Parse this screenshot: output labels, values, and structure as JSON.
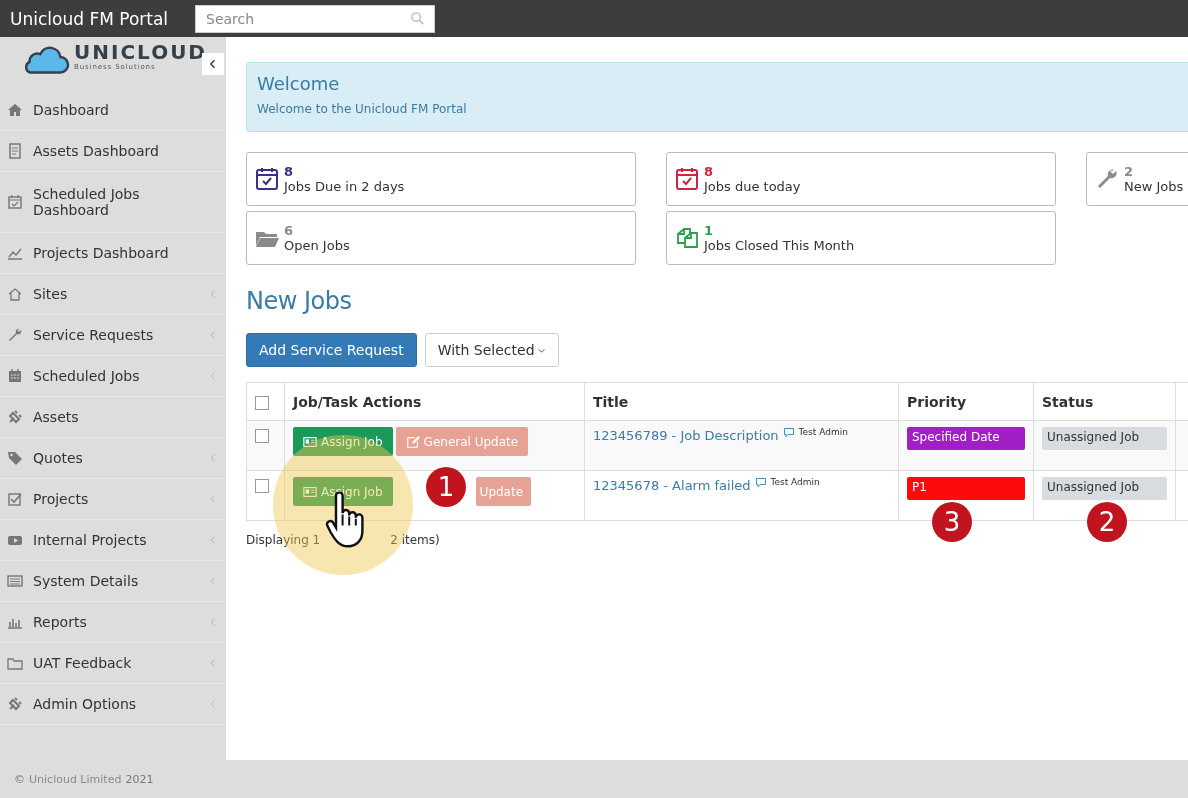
{
  "topbar": {
    "title": "Unicloud FM Portal",
    "search": {
      "placeholder": "Search"
    }
  },
  "logo": {
    "name": "UNICLOUD",
    "tagline": "Business Solutions"
  },
  "sidebar": {
    "items": [
      {
        "label": "Dashboard",
        "expandable": false
      },
      {
        "label": "Assets Dashboard",
        "expandable": false
      },
      {
        "label": "Scheduled Jobs Dashboard",
        "expandable": false
      },
      {
        "label": "Projects Dashboard",
        "expandable": false
      },
      {
        "label": "Sites",
        "expandable": true
      },
      {
        "label": "Service Requests",
        "expandable": true
      },
      {
        "label": "Scheduled Jobs",
        "expandable": true
      },
      {
        "label": "Assets",
        "expandable": false
      },
      {
        "label": "Quotes",
        "expandable": true
      },
      {
        "label": "Projects",
        "expandable": true
      },
      {
        "label": "Internal Projects",
        "expandable": true
      },
      {
        "label": "System Details",
        "expandable": true
      },
      {
        "label": "Reports",
        "expandable": true
      },
      {
        "label": "UAT Feedback",
        "expandable": true
      },
      {
        "label": "Admin Options",
        "expandable": true
      }
    ]
  },
  "welcome": {
    "title": "Welcome",
    "text": "Welcome to the Unicloud FM Portal"
  },
  "cards": [
    {
      "count": "8",
      "label": "Jobs Due in 2 days",
      "color": "#3b2f86"
    },
    {
      "count": "8",
      "label": "Jobs due today",
      "color": "#c8283c"
    },
    {
      "count": "2",
      "label": "New Jobs",
      "color": "#8a8a8a"
    },
    {
      "count": "6",
      "label": "Open Jobs",
      "color": "#8a8a8a"
    },
    {
      "count": "1",
      "label": "Jobs Closed This Month",
      "color": "#2e9e4a"
    }
  ],
  "section_title": "New Jobs",
  "buttons": {
    "add": "Add Service Request",
    "with_selected": "With Selected"
  },
  "table": {
    "select_all_checked": false,
    "columns": [
      "Job/Task Actions",
      "Title",
      "Priority",
      "Status"
    ],
    "rows": [
      {
        "checked": false,
        "assign": {
          "label": "Assign Job",
          "disabled": false
        },
        "update": {
          "label": "General Update",
          "disabled": true
        },
        "title": "123456789 - Job Description",
        "author": "Test Admin",
        "priority": "Specified Date",
        "color": "#a11fc4",
        "status": "Unassigned Job"
      },
      {
        "checked": false,
        "assign": {
          "label": "Assign Job",
          "disabled": false
        },
        "update": {
          "label": "Update",
          "disabled": true
        },
        "title": "12345678 - Alarm failed",
        "author": "Test Admin",
        "priority": "P1",
        "color": "#ff0a0a",
        "status": "Unassigned Job"
      }
    ]
  },
  "pager": {
    "start": "Displaying 1",
    "end": "2 items)"
  },
  "callouts": [
    "1",
    "3",
    "2"
  ],
  "footer": {
    "symbol": "©",
    "company": "Unicloud Limited",
    "year": "2021"
  }
}
